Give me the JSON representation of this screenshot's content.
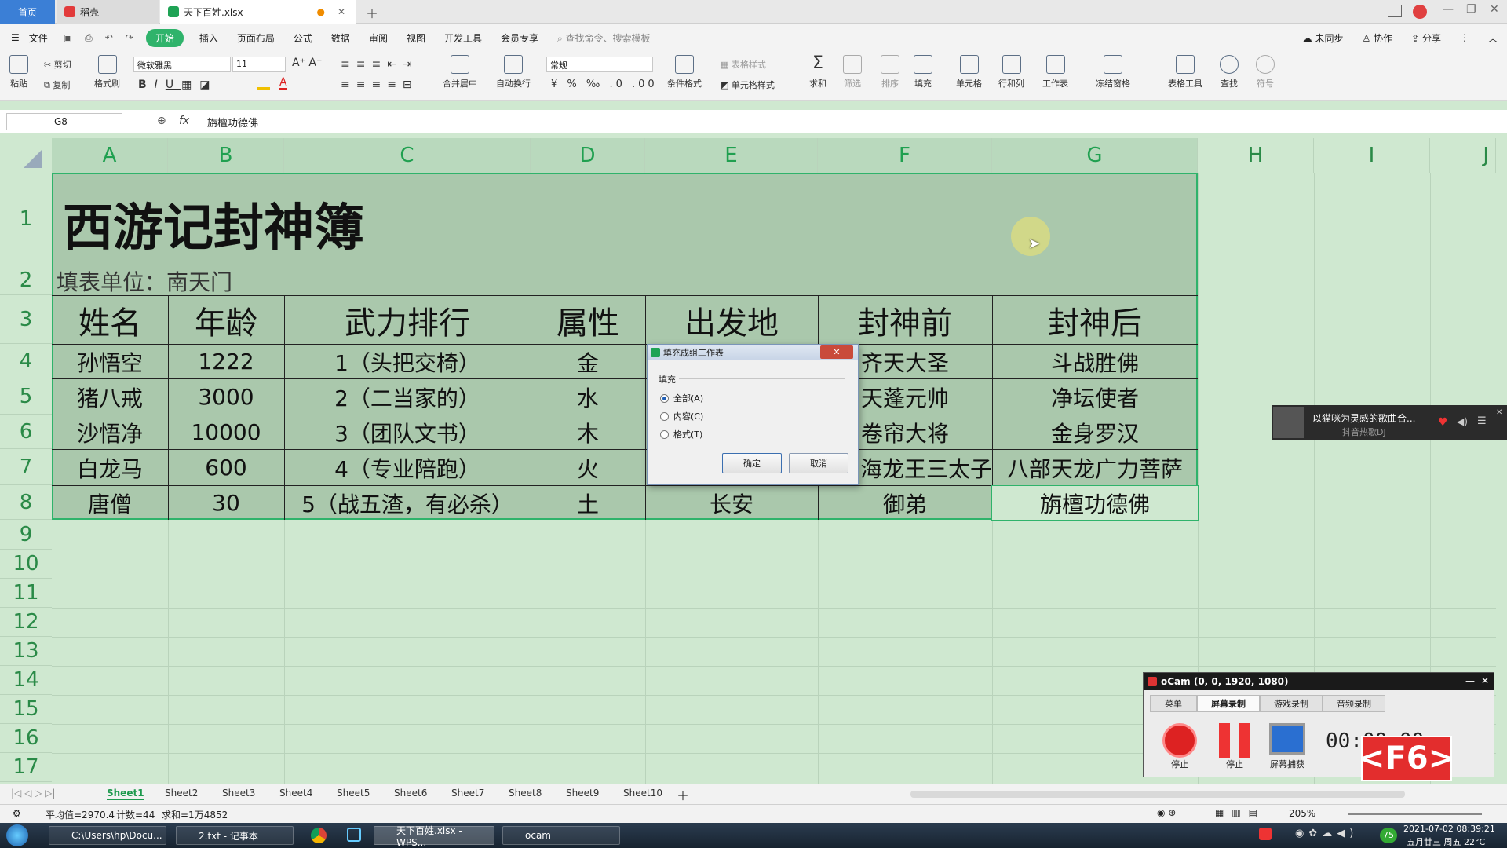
{
  "titlebar": {
    "home_tab": "首页",
    "docer_tab": "稻壳",
    "file_tab": "天下百姓.xlsx",
    "new_tab_icon": "plus-icon"
  },
  "menu": {
    "file": "文件",
    "start": "开始",
    "items": [
      "插入",
      "页面布局",
      "公式",
      "数据",
      "审阅",
      "视图",
      "开发工具",
      "会员专享"
    ],
    "search_placeholder": "查找命令、搜索模板",
    "sync": "未同步",
    "collab": "协作",
    "share": "分享"
  },
  "ribbon": {
    "paste": "粘贴",
    "cut": "剪切",
    "copy": "复制",
    "format_painter": "格式刷",
    "font_name": "微软雅黑",
    "font_size": "11",
    "merge_center": "合并居中",
    "wrap": "自动换行",
    "number_format": "常规",
    "table_style": "表格样式",
    "cond_format": "条件格式",
    "cell_style": "单元格样式",
    "sum": "求和",
    "filter": "筛选",
    "sort": "排序",
    "fill": "填充",
    "cells": "单元格",
    "rowcol": "行和列",
    "worksheet": "工作表",
    "freeze": "冻结窗格",
    "table_tools": "表格工具",
    "find": "查找",
    "symbol": "符号"
  },
  "formula_bar": {
    "cell_ref": "G8",
    "fx": "fx",
    "value": "旃檀功德佛"
  },
  "columns": [
    "A",
    "B",
    "C",
    "D",
    "E",
    "F",
    "G",
    "H",
    "I",
    "J"
  ],
  "rows": [
    "1",
    "2",
    "3",
    "4",
    "5",
    "6",
    "7",
    "8",
    "9",
    "10",
    "11",
    "12",
    "13",
    "14",
    "15",
    "16",
    "17"
  ],
  "sheet": {
    "title": "西游记封神簿",
    "unit": "填表单位：南天门",
    "headers": [
      "姓名",
      "年龄",
      "武力排行",
      "属性",
      "出发地",
      "封神前",
      "封神后"
    ],
    "data": [
      [
        "孙悟空",
        "1222",
        "1（头把交椅）",
        "金",
        "",
        "齐天大圣",
        "斗战胜佛"
      ],
      [
        "猪八戒",
        "3000",
        "2（二当家的）",
        "水",
        "",
        "天蓬元帅",
        "净坛使者"
      ],
      [
        "沙悟净",
        "10000",
        "3（团队文书）",
        "木",
        "",
        "卷帘大将",
        "金身罗汉"
      ],
      [
        "白龙马",
        "600",
        "4（专业陪跑）",
        "火",
        "",
        "海龙王三太子",
        "八部天龙广力菩萨"
      ],
      [
        "唐僧",
        "30",
        "5（战五渣，有必杀）",
        "土",
        "长安",
        "御弟",
        "旃檀功德佛"
      ]
    ]
  },
  "dialog": {
    "title": "填充成组工作表",
    "group_label": "填充",
    "options": [
      "全部(A)",
      "内容(C)",
      "格式(T)"
    ],
    "selected": "全部(A)",
    "ok": "确定",
    "cancel": "取消"
  },
  "music_popup": {
    "title": "以猫咪为灵感的歌曲合...",
    "subtitle": "抖音热歌DJ"
  },
  "ocam": {
    "title": "oCam (0, 0, 1920, 1080)",
    "tabs": [
      "菜单",
      "屏幕录制",
      "游戏录制",
      "音频录制"
    ],
    "active_tab": "屏幕录制",
    "buttons": [
      "停止",
      "停止",
      "屏幕捕获"
    ],
    "timer": "00:00:00",
    "hotkey": "<F6>"
  },
  "sheet_tabs": [
    "Sheet1",
    "Sheet2",
    "Sheet3",
    "Sheet4",
    "Sheet5",
    "Sheet6",
    "Sheet7",
    "Sheet8",
    "Sheet9",
    "Sheet10"
  ],
  "active_sheet": "Sheet1",
  "status": {
    "average": "平均值=2970.4",
    "count": "计数=44",
    "sum": "求和=1万4852",
    "zoom": "205%"
  },
  "taskbar": {
    "items": [
      "C:\\Users\\hp\\Docu...",
      "2.txt - 记事本",
      "天下百姓.xlsx - WPS...",
      "ocam"
    ],
    "active_item": "天下百姓.xlsx - WPS...",
    "clock_time": "2021-07-02 08:39:21",
    "clock_date": "五月廿三 周五 22°C",
    "badge": "75"
  },
  "colors": {
    "accent_green": "#2fb36b",
    "grid_bg": "#cfe8d0",
    "table_bg": "#aac8ac",
    "header_text": "#2a8a47"
  }
}
